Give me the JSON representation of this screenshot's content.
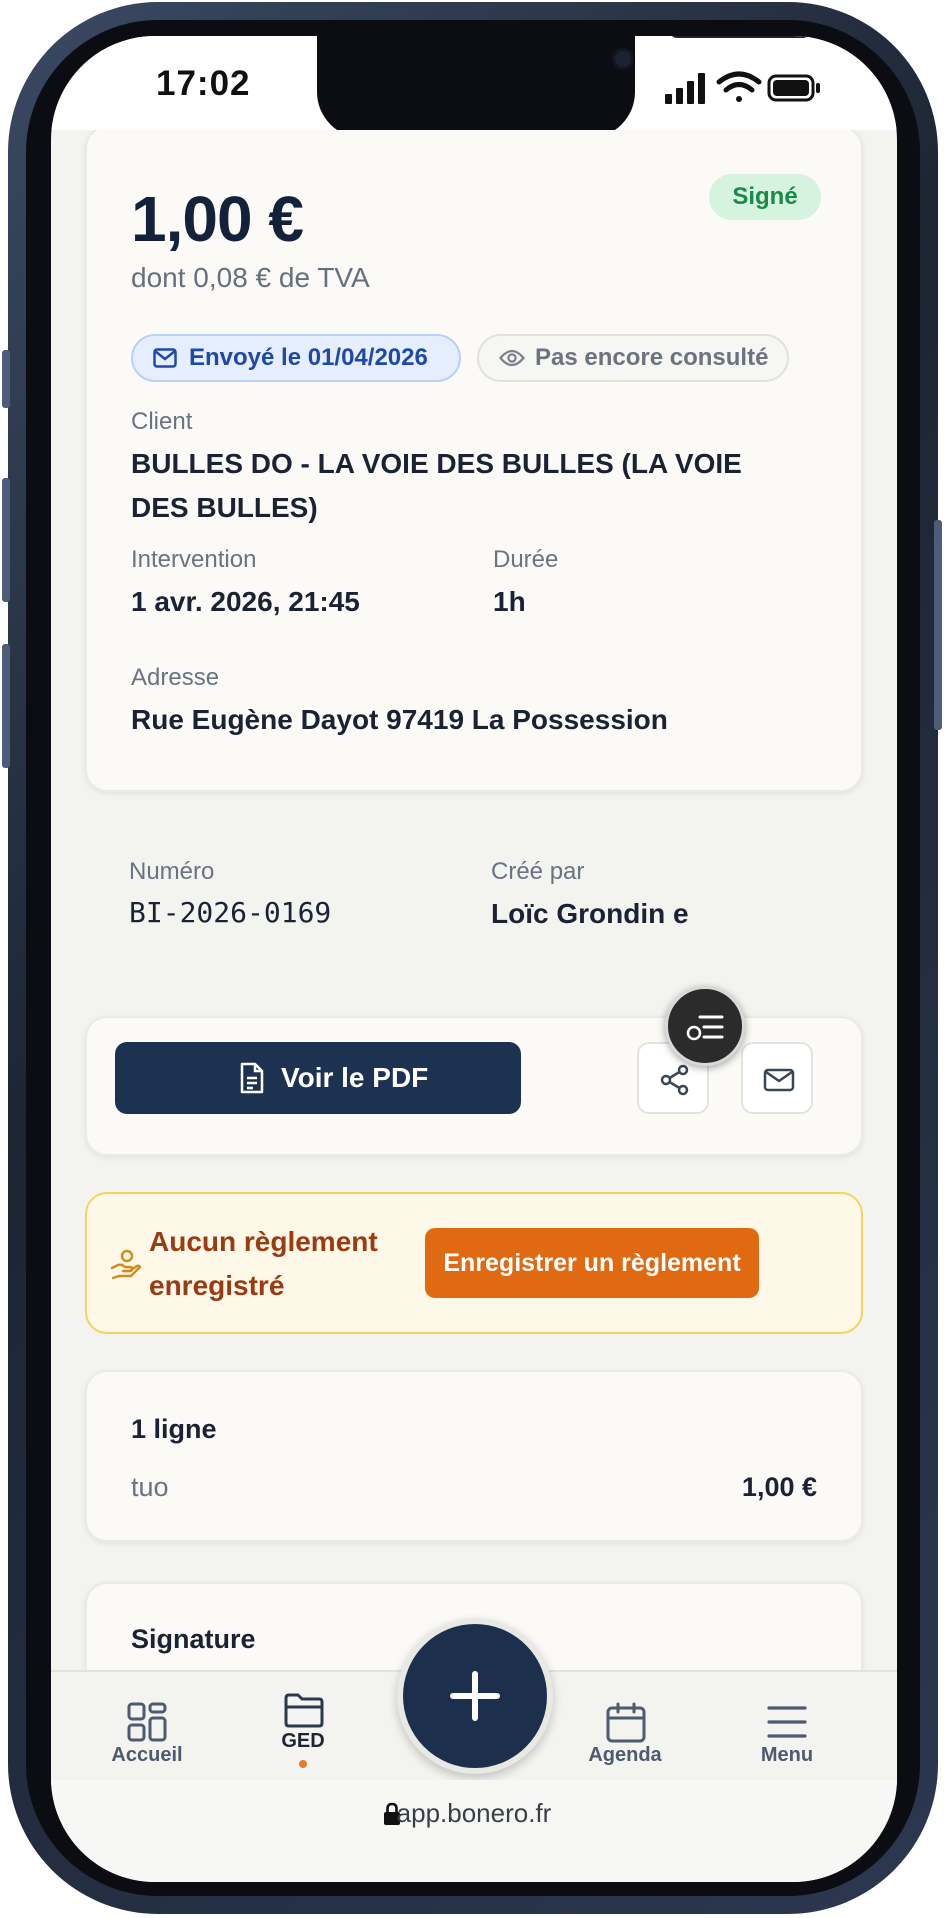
{
  "status_bar": {
    "time": "17:02"
  },
  "invoice": {
    "amount": "1,00 €",
    "vat": "dont 0,08 € de TVA",
    "status_badge": "Signé",
    "sent_pill": "Envoyé le 01/04/2026",
    "seen_pill": "Pas encore consulté",
    "client_label": "Client",
    "client_value": "BULLES DO - LA VOIE DES BULLES (LA VOIE DES BULLES)",
    "intervention_label": "Intervention",
    "intervention_value": "1 avr. 2026, 21:45",
    "duration_label": "Durée",
    "duration_value": "1h",
    "address_label": "Adresse",
    "address_value": "Rue Eugène Dayot 97419 La Possession",
    "number_label": "Numéro",
    "number_value": "BI-2026-0169",
    "created_by_label": "Créé par",
    "created_by_value": "Loïc Grondin e"
  },
  "actions": {
    "pdf_button": "Voir le PDF",
    "share_icon": "share-icon",
    "mail_icon": "mail-icon"
  },
  "payment": {
    "warning_text": "Aucun règlement enregistré",
    "register_button": "Enregistrer un règlement"
  },
  "lines": {
    "title": "1 ligne",
    "items": [
      {
        "name": "tuo",
        "price": "1,00 €"
      }
    ]
  },
  "signature": {
    "title": "Signature"
  },
  "nav": {
    "items": [
      {
        "label": "Accueil",
        "icon": "grid-icon"
      },
      {
        "label": "GED",
        "icon": "folder-icon"
      },
      {
        "label": "Agenda",
        "icon": "calendar-icon"
      },
      {
        "label": "Menu",
        "icon": "menu-icon"
      }
    ],
    "fab_icon": "plus-icon"
  },
  "browser": {
    "url": "app.bonero.fr"
  },
  "colors": {
    "primary": "#1d3250",
    "accent_orange": "#e06a12",
    "signed_green": "#1b8a48",
    "sent_blue": "#2048a8",
    "warning_text": "#9a3b12"
  }
}
